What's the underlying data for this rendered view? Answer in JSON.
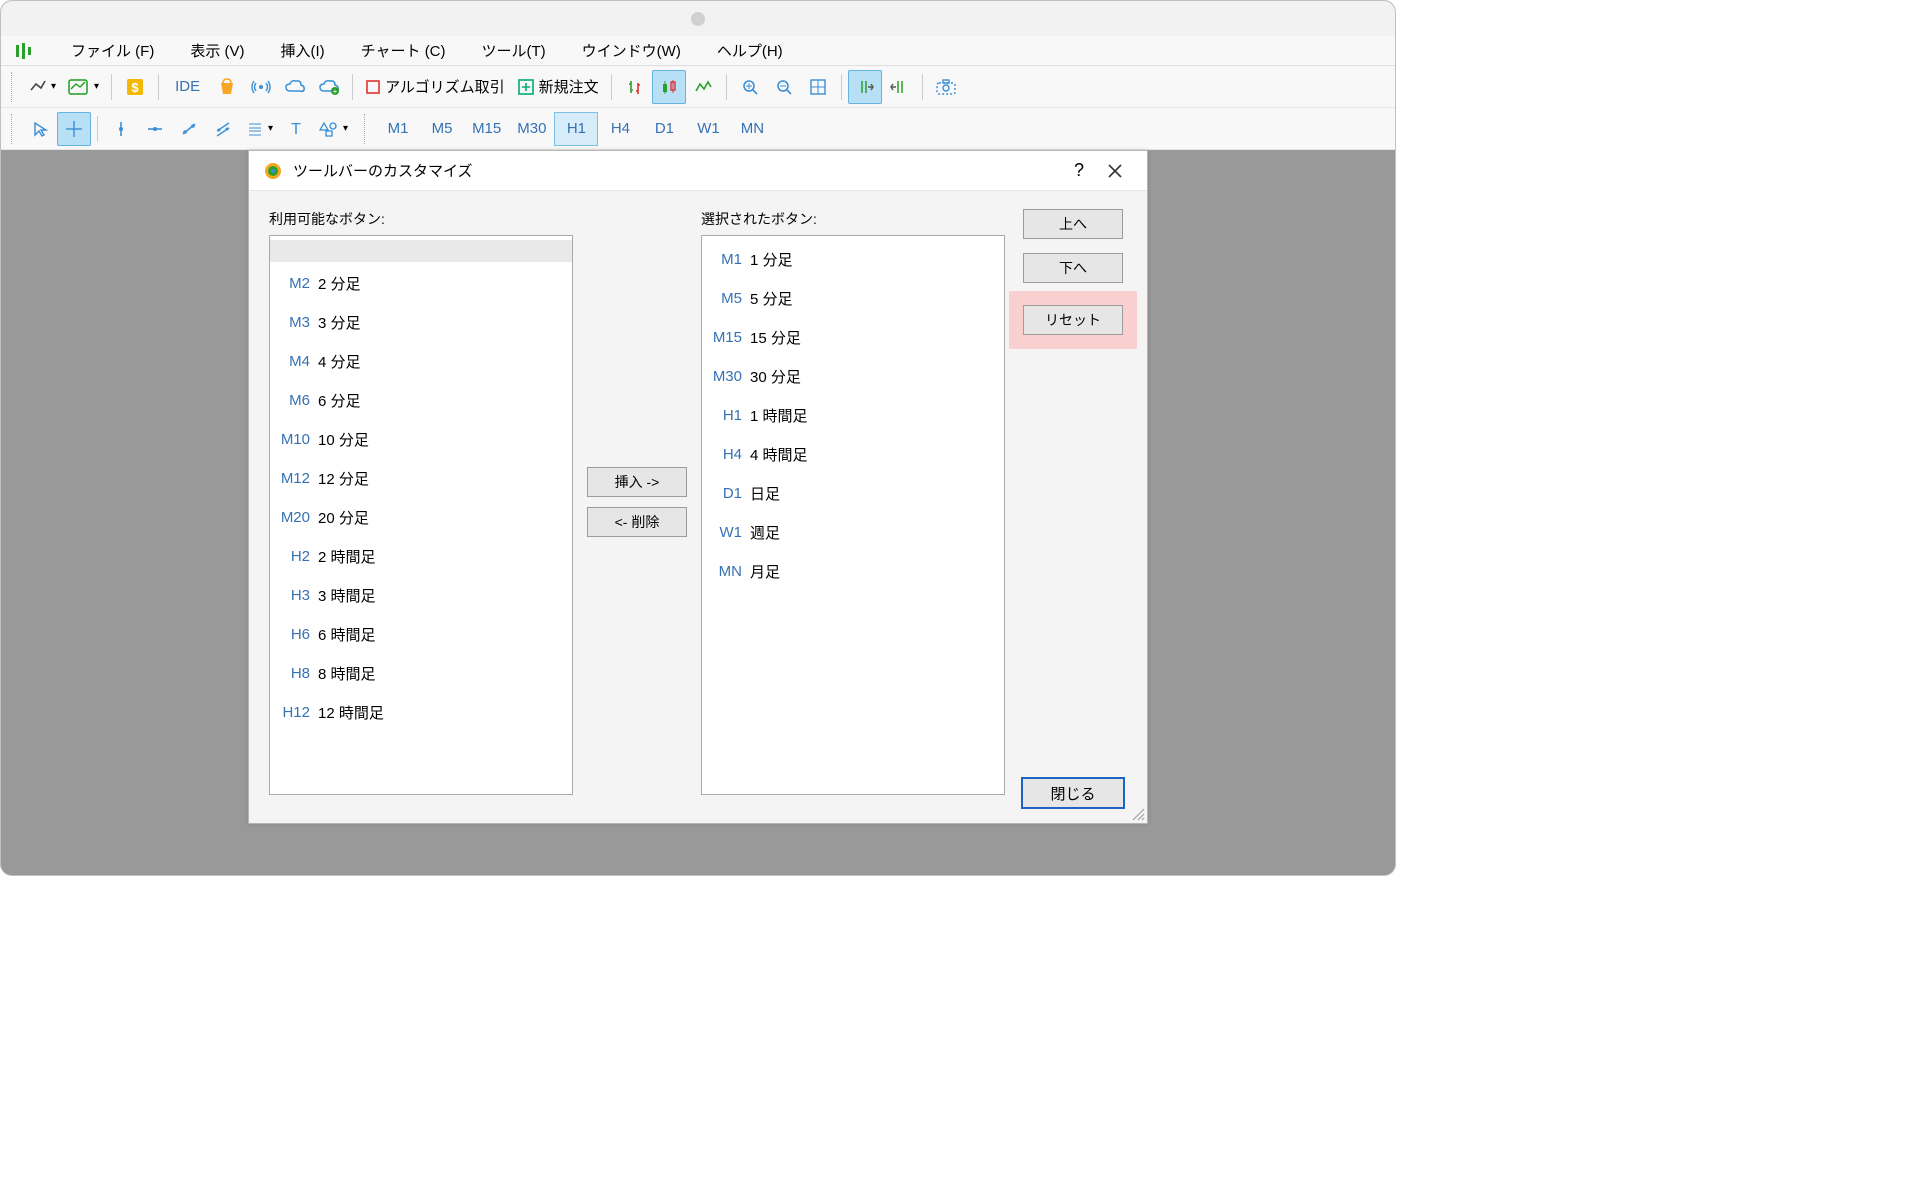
{
  "menu": {
    "file": "ファイル (F)",
    "view": "表示 (V)",
    "insert": "挿入(I)",
    "chart": "チャート (C)",
    "tool": "ツール(T)",
    "window": "ウインドウ(W)",
    "help": "ヘルプ(H)"
  },
  "toolbar1": {
    "ide": "IDE",
    "algo_label": "アルゴリズム取引",
    "new_order": "新規注文"
  },
  "timeframes": [
    "M1",
    "M5",
    "M15",
    "M30",
    "H1",
    "H4",
    "D1",
    "W1",
    "MN"
  ],
  "active_tf": "H1",
  "dialog": {
    "title": "ツールバーのカスタマイズ",
    "available_label": "利用可能なボタン:",
    "selected_label": "選択されたボタン:",
    "insert_btn": "挿入 ->",
    "delete_btn": "<- 削除",
    "up_btn": "上へ",
    "down_btn": "下へ",
    "reset_btn": "リセット",
    "close_btn": "閉じる"
  },
  "available": [
    {
      "code": "M2",
      "label": "2 分足"
    },
    {
      "code": "M3",
      "label": "3 分足"
    },
    {
      "code": "M4",
      "label": "4 分足"
    },
    {
      "code": "M6",
      "label": "6 分足"
    },
    {
      "code": "M10",
      "label": "10 分足"
    },
    {
      "code": "M12",
      "label": "12 分足"
    },
    {
      "code": "M20",
      "label": "20 分足"
    },
    {
      "code": "H2",
      "label": "2 時間足"
    },
    {
      "code": "H3",
      "label": "3 時間足"
    },
    {
      "code": "H6",
      "label": "6 時間足"
    },
    {
      "code": "H8",
      "label": "8 時間足"
    },
    {
      "code": "H12",
      "label": "12 時間足"
    }
  ],
  "selected": [
    {
      "code": "M1",
      "label": "1 分足"
    },
    {
      "code": "M5",
      "label": "5 分足"
    },
    {
      "code": "M15",
      "label": "15 分足"
    },
    {
      "code": "M30",
      "label": "30 分足"
    },
    {
      "code": "H1",
      "label": "1 時間足"
    },
    {
      "code": "H4",
      "label": "4 時間足"
    },
    {
      "code": "D1",
      "label": "日足"
    },
    {
      "code": "W1",
      "label": "週足"
    },
    {
      "code": "MN",
      "label": "月足"
    }
  ]
}
